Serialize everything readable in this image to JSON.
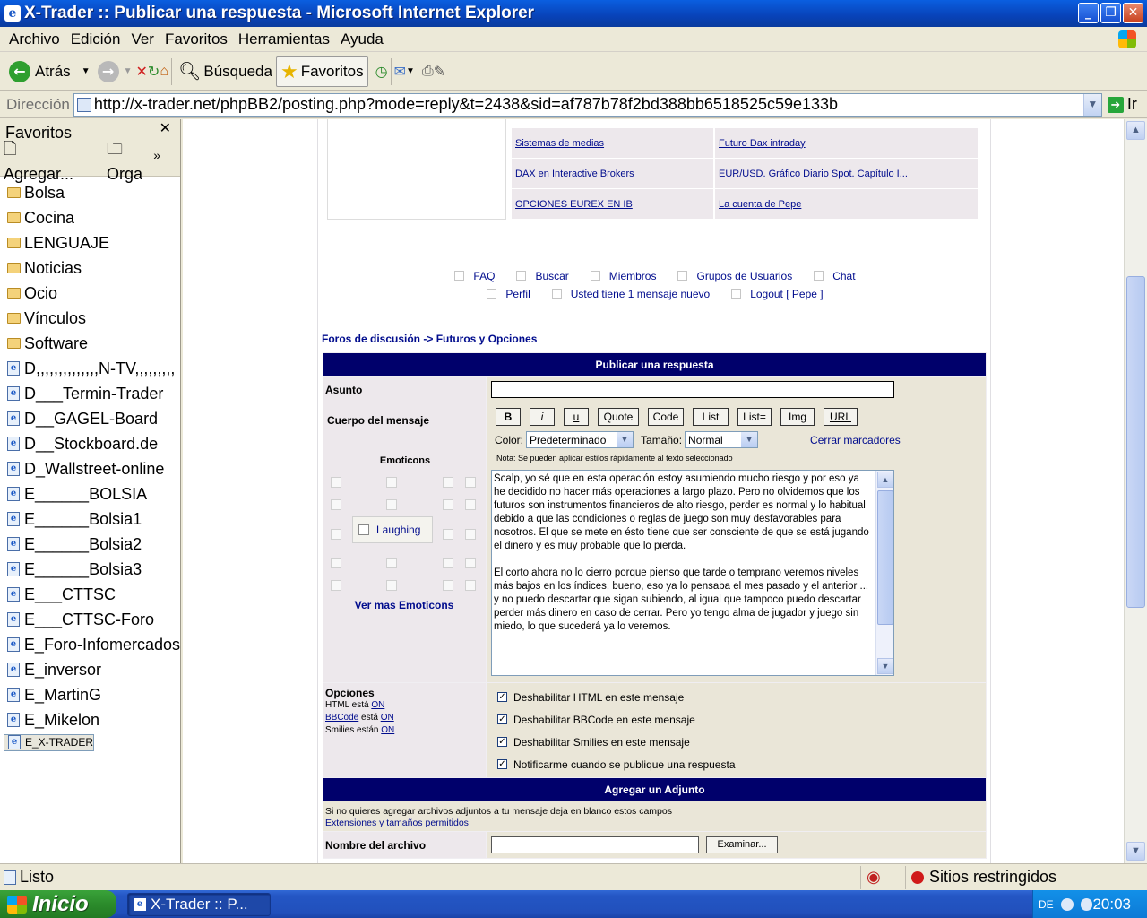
{
  "window": {
    "title": "X-Trader :: Publicar una respuesta - Microsoft Internet Explorer"
  },
  "menu": [
    "Archivo",
    "Edición",
    "Ver",
    "Favoritos",
    "Herramientas",
    "Ayuda"
  ],
  "toolbar": {
    "back": "Atrás",
    "search": "Búsqueda",
    "favorites": "Favoritos"
  },
  "address": {
    "label": "Dirección",
    "url": "http://x-trader.net/phpBB2/posting.php?mode=reply&t=2438&sid=af787b78f2bd388bb6518525c59e133b",
    "go": "Ir"
  },
  "favpane": {
    "title": "Favoritos",
    "add": "Agregar...",
    "organize": "Orga",
    "folders": [
      "Bolsa",
      "Cocina",
      "LENGUAJE",
      "Noticias",
      "Ocio",
      "Vínculos",
      "Software"
    ],
    "links": [
      "D,,,,,,,,,,,,,,N-TV,,,,,,,,,",
      "D___Termin-Trader",
      "D__GAGEL-Board",
      "D__Stockboard.de",
      "D_Wallstreet-online",
      "E______BOLSIA",
      "E______Bolsia1",
      "E______Bolsia2",
      "E______Bolsia3",
      "E___CTTSC",
      "E___CTTSC-Foro",
      "E_Foro-Infomercados",
      "E_inversor",
      "E_MartinG",
      "E_Mikelon",
      "E_X-TRADER"
    ],
    "selected": "E_X-TRADER"
  },
  "topics": [
    [
      "Sistemas de medias",
      "Futuro Dax intraday"
    ],
    [
      "DAX en Interactive Brokers",
      "EUR/USD. Gráfico Diario Spot. Capítulo I..."
    ],
    [
      "OPCIONES EUREX EN IB",
      "La cuenta de Pepe"
    ]
  ],
  "nav": {
    "line1": [
      "FAQ",
      "Buscar",
      "Miembros",
      "Grupos de Usuarios",
      "Chat"
    ],
    "line2": [
      "Perfil",
      "Usted tiene 1 mensaje nuevo",
      "Logout [ Pepe ]"
    ]
  },
  "breadcrumb": "Foros de discusión -> Futuros y Opciones",
  "form": {
    "header": "Publicar una respuesta",
    "subject_label": "Asunto",
    "subject_value": "",
    "body_label": "Cuerpo del mensaje",
    "bbcode": [
      "B",
      "i",
      "u",
      "Quote",
      "Code",
      "List",
      "List=",
      "Img",
      "URL"
    ],
    "color_label": "Color:",
    "color_value": "Predeterminado",
    "size_label": "Tamaño:",
    "size_value": "Normal",
    "close_tags": "Cerrar marcadores",
    "note": "Nota: Se pueden aplicar estilos rápidamente al texto seleccionado",
    "emoticons_label": "Emoticons",
    "emoticon_tooltip": "Laughing",
    "more_emoticons": "Ver mas Emoticons",
    "message_p1": "Scalp, yo sé que en esta operación estoy asumiendo mucho riesgo y por eso ya he decidido no hacer más operaciones a largo plazo. Pero no olvidemos que los futuros son instrumentos financieros de alto riesgo, perder es normal y lo habitual debido a que las condiciones o reglas de juego son muy desfavorables para nosotros. El que se mete en ésto tiene que ser consciente de que se está jugando el dinero y es muy probable que lo pierda.",
    "message_p2": "El corto ahora no lo cierro porque pienso que tarde o temprano veremos niveles más bajos en los índices, bueno, eso ya lo pensaba el mes pasado y el anterior ... y no puedo descartar que sigan subiendo, al igual que tampoco puedo descartar perder más dinero en caso de cerrar. Pero yo tengo alma de jugador y juego sin miedo, lo que sucederá ya lo veremos.",
    "options_label": "Opciones",
    "html_status": {
      "prefix": "HTML está",
      "value": "ON"
    },
    "bbcode_status": {
      "link": "BBCode",
      "mid": "está",
      "value": "ON"
    },
    "smilies_status": {
      "prefix": "Smilies están",
      "value": "ON"
    },
    "options": [
      "Deshabilitar HTML en este mensaje",
      "Deshabilitar BBCode en este mensaje",
      "Deshabilitar Smilies en este mensaje",
      "Notificarme cuando se publique una respuesta"
    ],
    "attach_header": "Agregar un Adjunto",
    "attach_note": "Si no quieres agregar archivos adjuntos a tu mensaje deja en blanco estos campos",
    "attach_link": "Extensiones y tamaños permitidos",
    "filename_label": "Nombre del archivo",
    "browse": "Examinar..."
  },
  "statusbar": {
    "text": "Listo",
    "zone": "Sitios restringidos"
  },
  "taskbar": {
    "start": "Inicio",
    "item": "X-Trader :: P...",
    "lang": "DE",
    "clock": "20:03"
  }
}
